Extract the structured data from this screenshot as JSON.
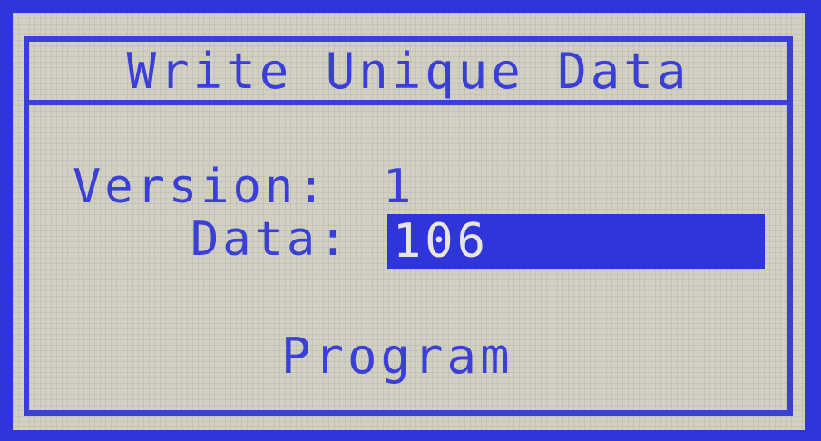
{
  "screen": {
    "title": "Write Unique Data",
    "fields": {
      "version_label": "Version:",
      "version_value": "1",
      "data_label": "Data:",
      "data_value": "106"
    },
    "program_label": "Program"
  },
  "colors": {
    "bezel": "#2f35d9",
    "lcd_background": "#d2cfc3",
    "lcd_foreground": "#3a3fd6",
    "highlight_background": "#2f35d9",
    "highlight_text": "#e8e6dc"
  }
}
